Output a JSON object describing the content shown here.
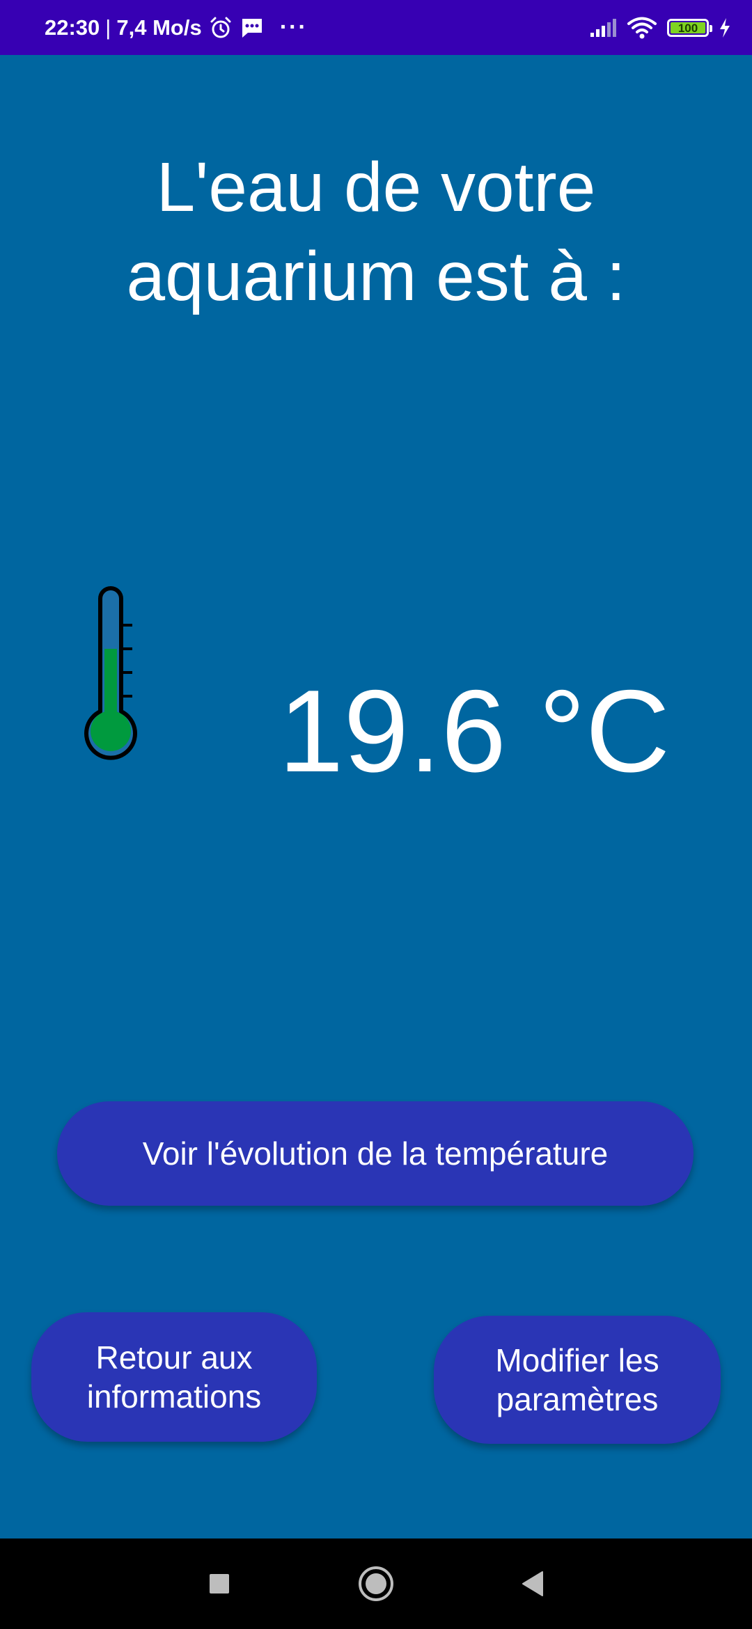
{
  "status_bar": {
    "time": "22:30",
    "separator": "|",
    "speed": "7,4 Mo/s",
    "more": "···",
    "battery_level": "100"
  },
  "main": {
    "headline": "L'eau de votre aquarium est à :",
    "temperature": "19.6 °C"
  },
  "buttons": {
    "evolution": "Voir l'évolution de la température",
    "back": "Retour aux informations",
    "settings": "Modifier les paramètres"
  },
  "colors": {
    "background": "#0066a0",
    "status_bar": "#3700b3",
    "button": "#2a35b5",
    "thermometer_fill": "#009a3e",
    "battery_fill": "#7ed321"
  }
}
